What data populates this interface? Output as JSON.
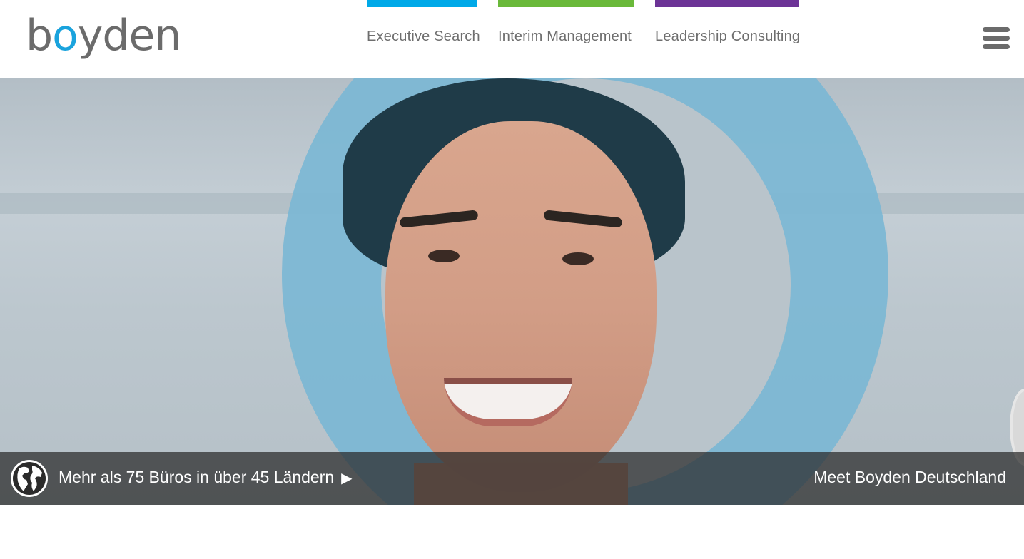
{
  "logo": {
    "pre": "b",
    "o": "o",
    "post": "yden",
    "brand_color": "#1aa3dd"
  },
  "nav": {
    "items": [
      {
        "label": "Executive Search",
        "color": "#00a9e8"
      },
      {
        "label": "Interim Management",
        "color": "#6ab93a"
      },
      {
        "label": "Leadership Consulting",
        "color": "#6c3396"
      }
    ]
  },
  "menu": {
    "icon": "hamburger-icon"
  },
  "hero": {
    "offices_text": "Mehr als 75 Büros in über 45 Ländern",
    "play_glyph": "▶",
    "globe_icon": "globe-icon",
    "meet_text": "Meet Boyden Deutschland"
  }
}
